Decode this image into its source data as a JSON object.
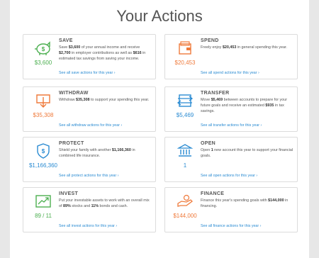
{
  "page_title": "Your Actions",
  "colors": {
    "green": "#4caf50",
    "orange": "#ef7a3b",
    "blue": "#2a8bd2"
  },
  "cards": {
    "save": {
      "icon": "piggy-bank-icon",
      "amount": "$3,600",
      "heading": "SAVE",
      "desc": [
        {
          "t": "Save "
        },
        {
          "t": "$3,600",
          "b": true
        },
        {
          "t": " of your annual income and receive "
        },
        {
          "t": "$2,700",
          "b": true
        },
        {
          "t": " in employer contributions as well as "
        },
        {
          "t": "$616",
          "b": true
        },
        {
          "t": " in estimated tax savings from saving your income."
        }
      ],
      "link": "See all save actions for this year"
    },
    "spend": {
      "icon": "wallet-icon",
      "amount": "$20,453",
      "heading": "SPEND",
      "desc": [
        {
          "t": "Freely enjoy "
        },
        {
          "t": "$20,453",
          "b": true
        },
        {
          "t": " in general spending this year."
        }
      ],
      "link": "See all spend actions for this year"
    },
    "withdraw": {
      "icon": "withdraw-icon",
      "amount": "$35,308",
      "heading": "WITHDRAW",
      "desc": [
        {
          "t": "Withdraw "
        },
        {
          "t": "$35,308",
          "b": true
        },
        {
          "t": " to support your spending this year."
        }
      ],
      "link": "See all withdraw actions for this year"
    },
    "transfer": {
      "icon": "transfer-icon",
      "amount": "$5,469",
      "heading": "TRANSFER",
      "desc": [
        {
          "t": "Move "
        },
        {
          "t": "$5,469",
          "b": true
        },
        {
          "t": " between accounts to prepare for your future goals and receive an estimated "
        },
        {
          "t": "$935",
          "b": true
        },
        {
          "t": " in tax savings."
        }
      ],
      "link": "See all transfer actions for this year"
    },
    "protect": {
      "icon": "shield-icon",
      "amount": "$1,166,360",
      "heading": "PROTECT",
      "desc": [
        {
          "t": "Shield your family with another "
        },
        {
          "t": "$1,166,360",
          "b": true
        },
        {
          "t": " in combined life insurance."
        }
      ],
      "link": "See all protect actions for this year"
    },
    "open": {
      "icon": "bank-icon",
      "amount": "1",
      "heading": "OPEN",
      "desc": [
        {
          "t": "Open "
        },
        {
          "t": "1",
          "b": true
        },
        {
          "t": " new account this year to support your financial goals."
        }
      ],
      "link": "See all open actions for this year"
    },
    "invest": {
      "icon": "growth-chart-icon",
      "amount": "89 / 11",
      "heading": "INVEST",
      "desc": [
        {
          "t": "Put your investable assets to work with an overall mix of "
        },
        {
          "t": "89%",
          "b": true
        },
        {
          "t": " stocks and "
        },
        {
          "t": "11%",
          "b": true
        },
        {
          "t": " bonds and cash."
        }
      ],
      "link": "See all invest actions for this year"
    },
    "finance": {
      "icon": "finance-hand-icon",
      "amount": "$144,000",
      "heading": "FINANCE",
      "desc": [
        {
          "t": "Finance this year's spending goals with "
        },
        {
          "t": "$144,000",
          "b": true
        },
        {
          "t": " in financing."
        }
      ],
      "link": "See all finance actions for this year"
    }
  }
}
